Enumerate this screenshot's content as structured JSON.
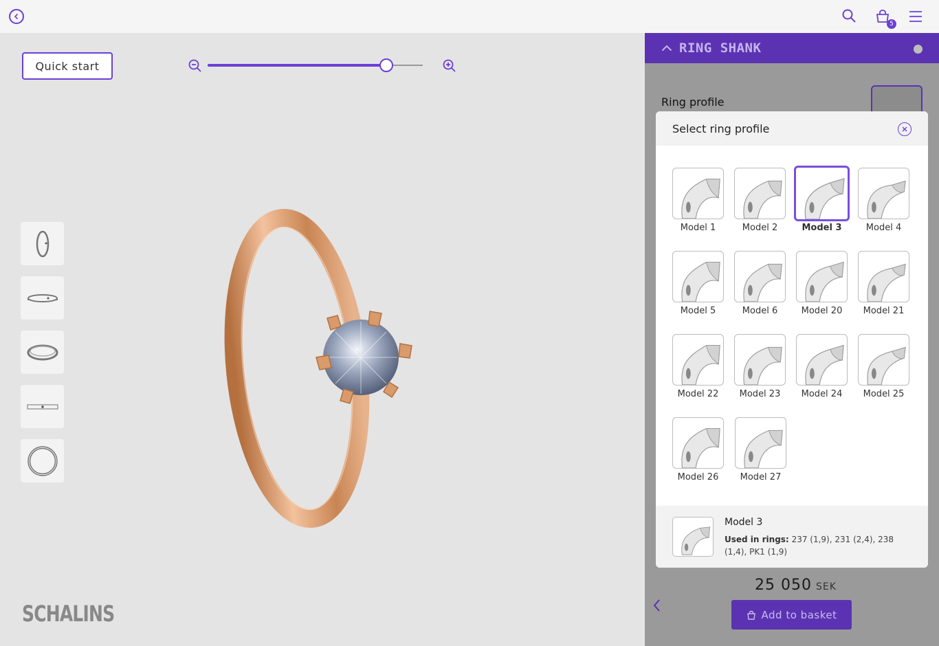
{
  "topbar": {
    "back_icon": "chevron-left-circle-icon",
    "search_icon": "search-icon",
    "basket_icon": "basket-icon",
    "basket_count": "5",
    "menu_icon": "menu-icon"
  },
  "viewer": {
    "quick_start_label": "Quick start",
    "zoom_level": 0.83,
    "view_thumbnails": [
      "side-view",
      "front-flat-view",
      "perspective-view",
      "top-flat-view",
      "top-view"
    ],
    "logo": "SCHALINS"
  },
  "panel": {
    "section_title": "RING SHANK",
    "ring_profile_label": "Ring profile",
    "price": "25 050",
    "currency": "SEK",
    "add_to_basket_label": "Add to basket"
  },
  "modal": {
    "title": "Select ring profile",
    "models": [
      {
        "name": "Model 1",
        "selected": false
      },
      {
        "name": "Model 2",
        "selected": false
      },
      {
        "name": "Model 3",
        "selected": true
      },
      {
        "name": "Model 4",
        "selected": false
      },
      {
        "name": "Model 5",
        "selected": false
      },
      {
        "name": "Model 6",
        "selected": false
      },
      {
        "name": "Model 20",
        "selected": false
      },
      {
        "name": "Model 21",
        "selected": false
      },
      {
        "name": "Model 22",
        "selected": false
      },
      {
        "name": "Model 23",
        "selected": false
      },
      {
        "name": "Model 24",
        "selected": false
      },
      {
        "name": "Model 25",
        "selected": false
      },
      {
        "name": "Model 26",
        "selected": false
      },
      {
        "name": "Model 27",
        "selected": false
      }
    ],
    "footer": {
      "title": "Model 3",
      "used_label": "Used in rings:",
      "used_value": "237 (1,9), 231 (2,4), 238 (1,4), PK1 (1,9)"
    }
  },
  "colors": {
    "accent": "#6b3fd6",
    "panel_header": "#5b33b2",
    "gold": "#d9a07a"
  }
}
